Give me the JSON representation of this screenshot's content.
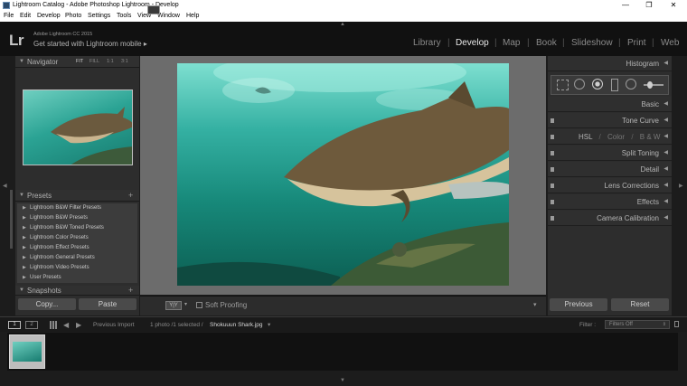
{
  "window": {
    "title": "Lightroom Catalog - Adobe Photoshop Lightroom - Develop",
    "controls": {
      "minimize": "—",
      "maximize": "❐",
      "close": "✕"
    }
  },
  "menu": [
    "File",
    "Edit",
    "Develop",
    "Photo",
    "Settings",
    "Tools",
    "View",
    "Window",
    "Help"
  ],
  "identity": {
    "logo": "Lr",
    "subtitle": "Adobe Lightroom CC 2015",
    "title": "Get started with Lightroom mobile",
    "arrow": "▸"
  },
  "modules": [
    "Library",
    "Develop",
    "Map",
    "Book",
    "Slideshow",
    "Print",
    "Web"
  ],
  "active_module": "Develop",
  "left_panel": {
    "navigator": {
      "label": "Navigator",
      "options": [
        "FIT",
        "FILL",
        "1:1",
        "3:1"
      ],
      "selected": "FIT"
    },
    "presets": {
      "label": "Presets",
      "add": "+",
      "items": [
        "Lightroom B&W Filter Presets",
        "Lightroom B&W Presets",
        "Lightroom B&W Toned Presets",
        "Lightroom Color Presets",
        "Lightroom Effect Presets",
        "Lightroom General Presets",
        "Lightroom Video Presets",
        "User Presets"
      ]
    },
    "snapshots": {
      "label": "Snapshots",
      "add": "+"
    },
    "copy_button": "Copy...",
    "paste_button": "Paste"
  },
  "right_panel": {
    "histogram": "Histogram",
    "sections": [
      "Basic",
      "Tone Curve",
      "Detail",
      "Lens Corrections",
      "Effects",
      "Camera Calibration"
    ],
    "hsl": {
      "hsl": "HSL",
      "color": "Color",
      "bw": "B & W",
      "sep": "/"
    },
    "split_toning": "Split Toning",
    "previous_button": "Previous",
    "reset_button": "Reset"
  },
  "toolbar": {
    "view_mode": "Y|Y",
    "soft_proofing": "Soft Proofing"
  },
  "filmstrip": {
    "page1": "1",
    "page2": "2",
    "source": "Previous Import",
    "count": "1 photo /1 selected /",
    "filename": "Shokuuun Shark.jpg",
    "filename_arrow": "▾",
    "filter_label": "Filter :",
    "filter_value": "Filters Off"
  },
  "colors": {
    "background": "#1c1c1c",
    "panel": "#2d2d2d",
    "center": "#6c6c6c",
    "water": "#2ba394"
  }
}
